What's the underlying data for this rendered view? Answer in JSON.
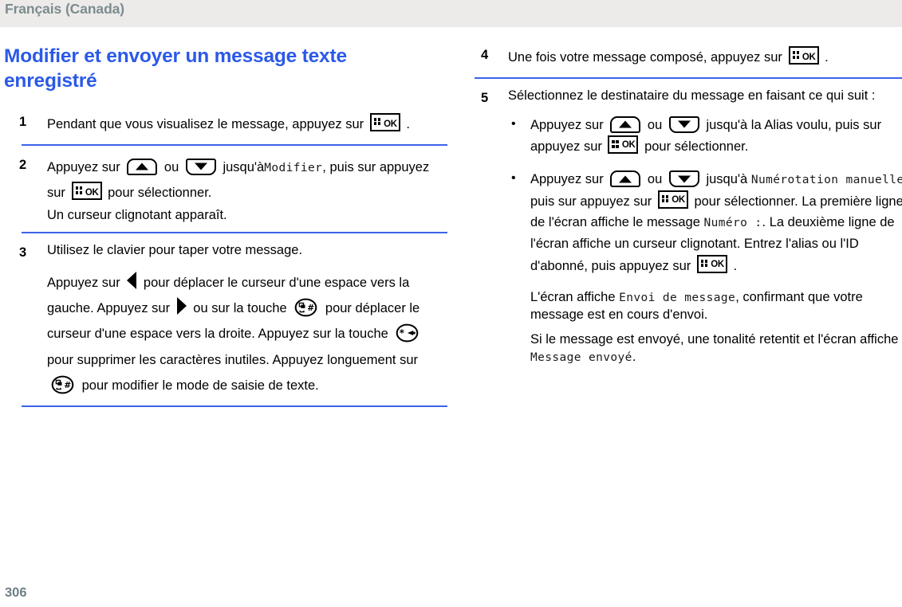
{
  "header": {
    "language_label": "Français (Canada)"
  },
  "heading": "Modifier et envoyer un message texte enregistré",
  "left_column": {
    "steps": [
      {
        "number": "1",
        "text_before": "Pendant que vous visualisez le message, appuyez sur",
        "text_after": "."
      },
      {
        "number": "2",
        "line1_a": "Appuyez sur",
        "line1_b": "ou",
        "line1_c": "jusqu'à",
        "line1_screen": "Modifier",
        "line1_d": ", puis",
        "line2_a": "sur appuyez sur",
        "line2_b": "pour sélectionner.",
        "line3": "Un curseur clignotant apparaît."
      },
      {
        "number": "3",
        "intro": "Utilisez le clavier pour taper votre message.",
        "body_1": "Appuyez sur",
        "body_2": "pour déplacer le curseur d'une espace vers la gauche. Appuyez sur",
        "body_3": "ou sur la touche",
        "body_4": "pour déplacer le curseur d'une espace vers la droite. Appuyez sur la touche",
        "body_5": "pour supprimer les caractères inutiles. Appuyez longuement sur",
        "body_6": "pour modifier le mode de saisie de texte."
      }
    ]
  },
  "right_column": {
    "steps": [
      {
        "number": "4",
        "text_before": "Une fois votre message composé, appuyez sur",
        "text_after": "."
      },
      {
        "number": "5",
        "intro": "Sélectionnez le destinataire du message en faisant ce qui suit :",
        "bullets": [
          {
            "a": "Appuyez sur",
            "b": "ou",
            "c": "jusqu'à la Alias voulu, puis sur appuyez sur",
            "d": "pour sélectionner."
          },
          {
            "a": "Appuyez sur",
            "b": "ou",
            "c": "jusqu'à",
            "screen_1": "Numérotation manuelle",
            "d": ", puis sur appuyez sur",
            "e": "pour sélectionner. La première ligne de l'écran affiche le message",
            "screen_2": "Numéro :",
            "f": ". La deuxième ligne de l'écran affiche un curseur clignotant. Entrez l'alias ou l'ID d'abonné, puis appuyez sur",
            "g": "."
          }
        ],
        "notes": [
          {
            "a": "L'écran affiche",
            "screen": "Envoi de message",
            "b": ", confirmant que votre message est en cours d'envoi."
          },
          {
            "a": "Si le message est envoyé, une tonalité retentit et l'écran affiche",
            "screen": "Message envoyé",
            "b": "."
          }
        ]
      }
    ]
  },
  "footer": {
    "page_number": "306"
  },
  "colors": {
    "heading": "#2b59e8",
    "rule": "#3c63e8",
    "header_text": "#7d8c8f",
    "header_band": "#ecebe9",
    "page_number": "#6f8086"
  },
  "icons": {
    "ok_key_label": "OK",
    "up_key": "nav-up-key",
    "down_key": "nav-down-key",
    "left_arrow": "arrow-left",
    "right_arrow": "arrow-right",
    "hash_key": "hash-smiley-key",
    "star_key": "star-delete-key"
  }
}
